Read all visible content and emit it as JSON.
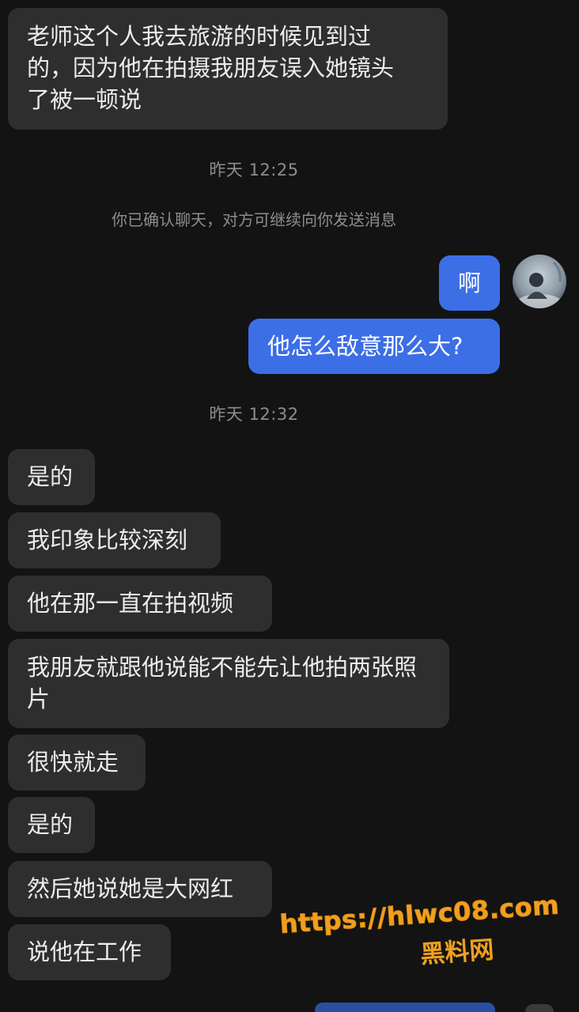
{
  "conversation": {
    "header_message": {
      "lines": [
        "老师这个人我去旅游的时候见到过",
        "的，因为他在拍摄我朋友误入她镜头",
        "了被一顿说"
      ]
    },
    "time_1": "昨天 12:25",
    "notice": "你已确认聊天，对方可继续向你发送消息",
    "sent": [
      {
        "text": "啊"
      },
      {
        "text": "他怎么敌意那么大?"
      }
    ],
    "time_2": "昨天 12:32",
    "received": [
      {
        "text": "是的"
      },
      {
        "text": "我印象比较深刻"
      },
      {
        "text": "他在那一直在拍视频"
      },
      {
        "text": "我朋友就跟他说能不能先让他拍两张照片"
      },
      {
        "text": "很快就走"
      },
      {
        "text": "是的"
      },
      {
        "text": "然后她说她是大网红"
      },
      {
        "text": "说他在工作"
      }
    ]
  },
  "watermark": {
    "url": "https://hlwc08.com",
    "name": "黑料网"
  },
  "colors": {
    "background": "#131313",
    "incoming_bubble": "#2e2e2e",
    "outgoing_bubble": "#3c6ee6",
    "timestamp_text": "#8d8d8d",
    "watermark": "#f0a020"
  },
  "icons": {
    "avatar": "user-avatar-photo"
  }
}
